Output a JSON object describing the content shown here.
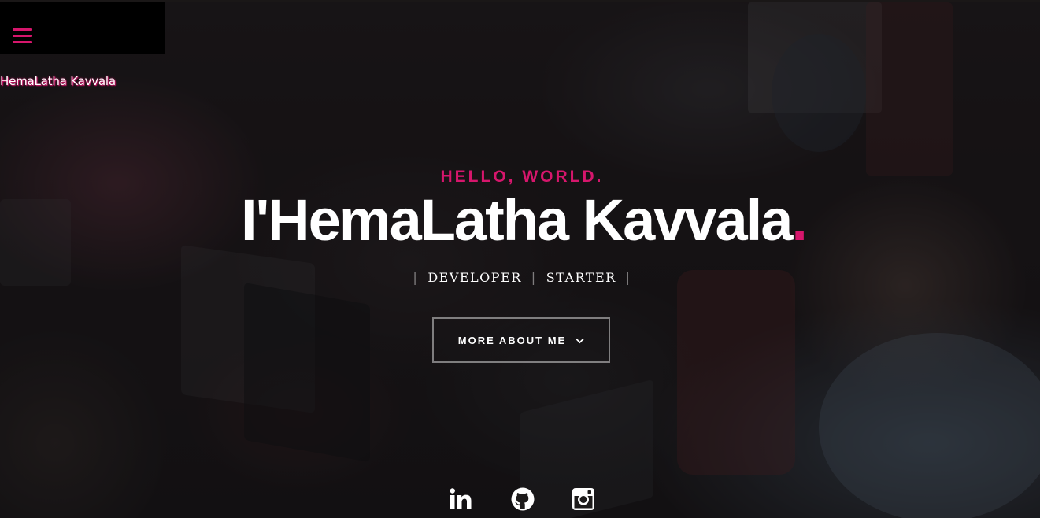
{
  "header": {
    "menu_icon": "hamburger-menu-icon",
    "brand": "HemaLatha Kavvala"
  },
  "hero": {
    "greeting": "HELLO, WORLD.",
    "title": "I'HemaLatha Kavvala",
    "title_dot": ".",
    "roles": [
      "DEVELOPER",
      "STARTER"
    ],
    "separator": "|",
    "button_label": "MORE ABOUT ME",
    "button_icon": "chevron-down-icon"
  },
  "social": {
    "icons": [
      "linkedin-icon",
      "github-icon",
      "instagram-icon"
    ]
  },
  "colors": {
    "accent": "#d6166c",
    "text": "#ffffff",
    "menu_bg": "#000000"
  }
}
